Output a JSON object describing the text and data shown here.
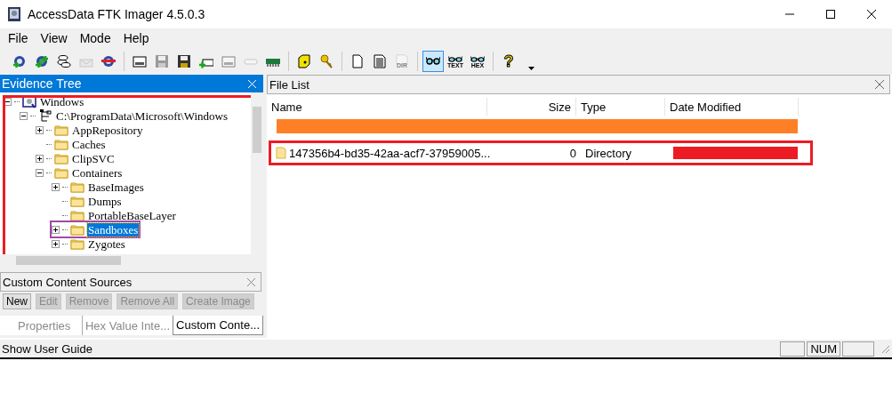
{
  "window": {
    "title": "AccessData FTK Imager 4.5.0.3"
  },
  "menu": [
    "File",
    "View",
    "Mode",
    "Help"
  ],
  "toolbar": [
    {
      "kind": "add-evidence",
      "disabled": false,
      "selected": false
    },
    {
      "kind": "add-all",
      "disabled": false,
      "selected": false
    },
    {
      "kind": "discs",
      "disabled": false,
      "selected": false
    },
    {
      "kind": "envelope",
      "disabled": true,
      "selected": false
    },
    {
      "kind": "remove-evidence",
      "disabled": false,
      "selected": false
    },
    {
      "kind": "sep"
    },
    {
      "kind": "drive",
      "disabled": false,
      "selected": false
    },
    {
      "kind": "floppy",
      "disabled": true,
      "selected": false
    },
    {
      "kind": "floppy",
      "disabled": false,
      "selected": false
    },
    {
      "kind": "drive-add",
      "disabled": false,
      "selected": false
    },
    {
      "kind": "drive",
      "disabled": true,
      "selected": false
    },
    {
      "kind": "connector",
      "disabled": true,
      "selected": false
    },
    {
      "kind": "memory",
      "disabled": false,
      "selected": false
    },
    {
      "kind": "sep"
    },
    {
      "kind": "box",
      "disabled": false,
      "selected": false
    },
    {
      "kind": "key",
      "disabled": false,
      "selected": false
    },
    {
      "kind": "sep"
    },
    {
      "kind": "page",
      "disabled": false,
      "selected": false
    },
    {
      "kind": "text-page",
      "disabled": false,
      "selected": false
    },
    {
      "kind": "label-page",
      "label": "DIR",
      "disabled": true,
      "selected": false
    },
    {
      "kind": "sep"
    },
    {
      "kind": "glasses",
      "disabled": false,
      "selected": true
    },
    {
      "kind": "glasses",
      "label": "TEXT",
      "disabled": false,
      "selected": false
    },
    {
      "kind": "glasses",
      "label": "HEX",
      "disabled": false,
      "selected": false
    },
    {
      "kind": "sep"
    },
    {
      "kind": "help",
      "label": "?",
      "disabled": false,
      "selected": false
    },
    {
      "kind": "dropdown",
      "disabled": false,
      "selected": false
    }
  ],
  "evidence_tree": {
    "title": "Evidence Tree",
    "annotated": true,
    "items": [
      {
        "label": "Windows",
        "kind": "evidence",
        "expandable": true,
        "expanded": true,
        "selected": false,
        "annotated": false,
        "children": [
          {
            "label": "C:\\ProgramData\\Microsoft\\Windows",
            "kind": "root",
            "expandable": true,
            "expanded": true,
            "selected": false,
            "annotated": false,
            "children": [
              {
                "label": "AppRepository",
                "kind": "folder",
                "expandable": true,
                "expanded": false,
                "selected": false,
                "annotated": false
              },
              {
                "label": "Caches",
                "kind": "folder",
                "expandable": false,
                "expanded": false,
                "selected": false,
                "annotated": false
              },
              {
                "label": "ClipSVC",
                "kind": "folder",
                "expandable": true,
                "expanded": false,
                "selected": false,
                "annotated": false
              },
              {
                "label": "Containers",
                "kind": "folder",
                "expandable": true,
                "expanded": true,
                "selected": false,
                "annotated": false,
                "children": [
                  {
                    "label": "BaseImages",
                    "kind": "folder",
                    "expandable": true,
                    "expanded": false,
                    "selected": false,
                    "annotated": false
                  },
                  {
                    "label": "Dumps",
                    "kind": "folder",
                    "expandable": false,
                    "expanded": false,
                    "selected": false,
                    "annotated": false
                  },
                  {
                    "label": "PortableBaseLayer",
                    "kind": "folder",
                    "expandable": false,
                    "expanded": false,
                    "selected": false,
                    "annotated": false
                  },
                  {
                    "label": "Sandboxes",
                    "kind": "folder",
                    "expandable": true,
                    "expanded": false,
                    "selected": true,
                    "annotated": true
                  },
                  {
                    "label": "Zygotes",
                    "kind": "folder",
                    "expandable": true,
                    "expanded": false,
                    "selected": false,
                    "annotated": false
                  }
                ]
              }
            ]
          }
        ]
      }
    ]
  },
  "custom_content_sources": {
    "title": "Custom Content Sources",
    "buttons": [
      {
        "label": "New",
        "disabled": false
      },
      {
        "label": "Edit",
        "disabled": true
      },
      {
        "label": "Remove",
        "disabled": true
      },
      {
        "label": "Remove All",
        "disabled": true
      },
      {
        "label": "Create Image",
        "disabled": true
      }
    ]
  },
  "tabs": [
    {
      "label": "Properties",
      "selected": false
    },
    {
      "label": "Hex Value Inte...",
      "selected": false
    },
    {
      "label": "Custom Conte...",
      "selected": true
    }
  ],
  "file_list": {
    "title": "File List",
    "columns": [
      "Name",
      "Size",
      "Type",
      "Date Modified"
    ],
    "rows": [
      {
        "kind": "redacted",
        "annotated": false
      },
      {
        "kind": "entry",
        "name": "147356b4-bd35-42aa-acf7-37959005...",
        "size": "0",
        "type": "Directory",
        "date_redacted": true,
        "annotated": true
      }
    ]
  },
  "status_bar": {
    "text": "Show User Guide",
    "indicators": [
      "NUM"
    ]
  }
}
